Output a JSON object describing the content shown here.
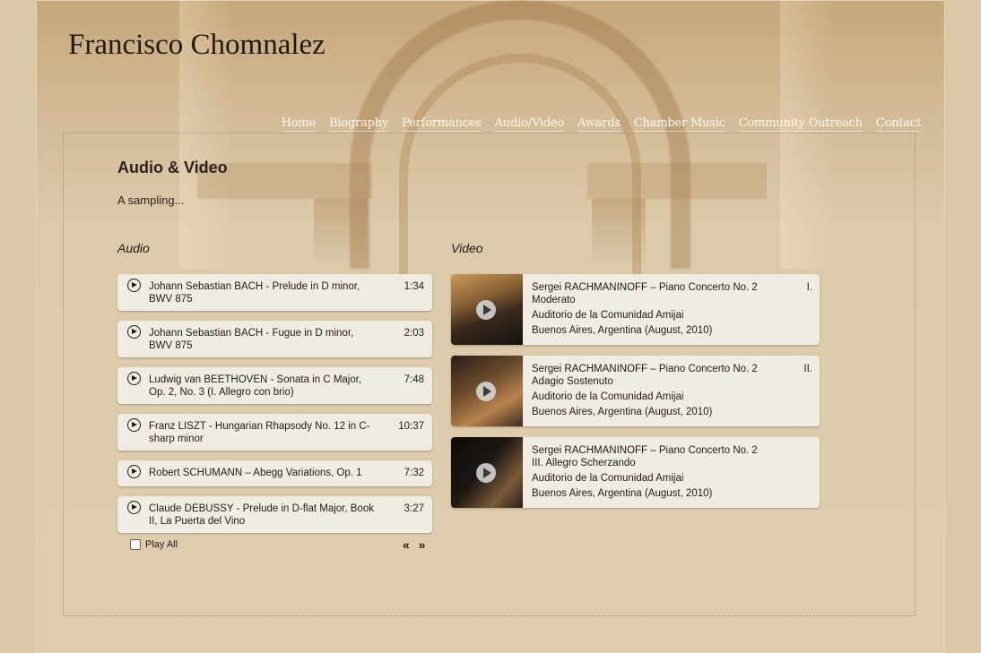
{
  "site": {
    "title": "Francisco Chomnalez"
  },
  "nav": [
    "Home",
    "Biography",
    "Performances",
    "Audio/Video",
    "Awards",
    "Chamber Music",
    "Community Outreach",
    "Contact"
  ],
  "page": {
    "heading": "Audio & Video",
    "intro": "A sampling..."
  },
  "audio": {
    "title": "Audio",
    "tracks": [
      {
        "name": "Johann Sebastian BACH - Prelude in D minor, BWV 875",
        "duration": "1:34"
      },
      {
        "name": "Johann Sebastian BACH - Fugue in D minor, BWV 875",
        "duration": "2:03"
      },
      {
        "name": "Ludwig van BEETHOVEN - Sonata in C Major, Op. 2, No. 3 (I. Allegro con brio)",
        "duration": "7:48"
      },
      {
        "name": "Franz LISZT - Hungarian Rhapsody No. 12 in C-sharp minor",
        "duration": "10:37"
      },
      {
        "name": "Robert SCHUMANN – Abegg Variations, Op. 1",
        "duration": "7:32"
      },
      {
        "name": "Claude DEBUSSY - Prelude in D-flat Major, Book II, La Puerta del Vino",
        "duration": "3:27"
      }
    ],
    "play_all": "Play All",
    "pager": "« »"
  },
  "video": {
    "title": "Video",
    "items": [
      {
        "line1": "Sergei RACHMANINOFF – Piano Concerto No. 2",
        "part_num": "I.",
        "part_rest": "Moderato",
        "venue": "Auditorio de la Comunidad Amijai",
        "place": "Buenos Aires, Argentina (August, 2010)"
      },
      {
        "line1": "Sergei RACHMANINOFF – Piano Concerto No. 2",
        "part_num": "II.",
        "part_rest": "Adagio Sostenuto",
        "venue": "Auditorio de la Comunidad Amijai",
        "place": "Buenos Aires, Argentina (August, 2010)"
      },
      {
        "line1": "Sergei RACHMANINOFF – Piano Concerto No. 2",
        "part_num": "",
        "part_rest": "III. Allegro Scherzando",
        "venue": "Auditorio de la Comunidad Amijai",
        "place": "Buenos Aires, Argentina (August, 2010)"
      }
    ]
  },
  "icons": {
    "audio_play": "play-circle-icon",
    "video_play": "video-play-icon"
  },
  "colors": {
    "background": "#d9c8a6",
    "card": "#f1ece3",
    "nav_text": "#fffaf0",
    "text": "#1f1a14"
  }
}
